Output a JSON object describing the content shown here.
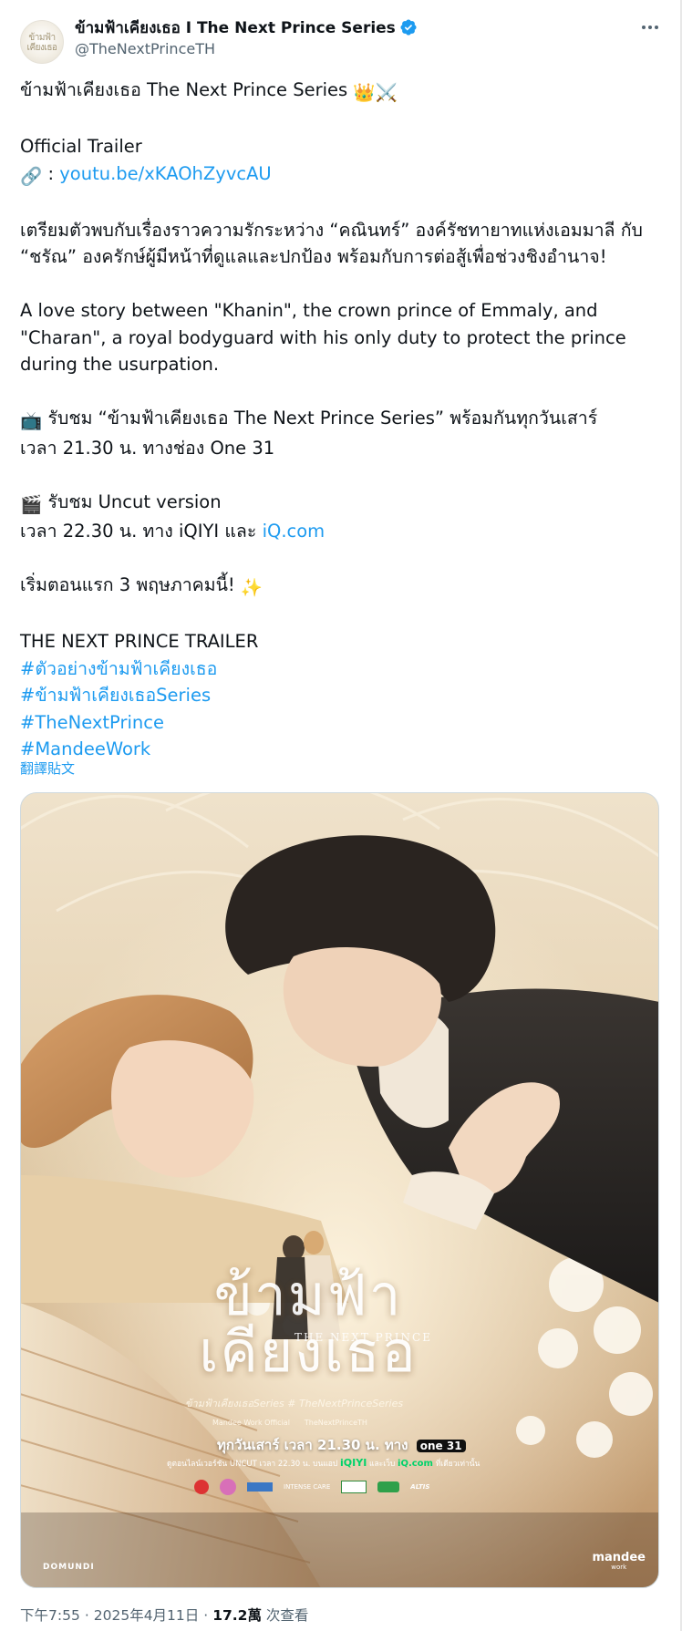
{
  "author": {
    "display_name": "ข้ามฟ้าเคียงเธอ I The Next Prince Series",
    "handle": "@TheNextPrinceTH",
    "avatar_text": "ข้ามฟ้า เคียงเธอ"
  },
  "tweet": {
    "line1": "ข้ามฟ้าเคียงเธอ The Next Prince Series",
    "line1_emoji": "👑⚔️",
    "official_trailer": "Official Trailer",
    "link_prefix_emoji": "🔗",
    "link_sep": " : ",
    "trailer_link": "youtu.be/xKAOhZyvcAU",
    "thai_para_1": "เตรียมตัวพบกับเรื่องราวความรักระหว่าง “คณินทร์” องค์รัชทายาทแห่งเอมมาลี กับ",
    "thai_para_2": "“ชรัณ” องครักษ์ผู้มีหน้าที่ดูแลและปกป้อง พร้อมกับการต่อสู้เพื่อช่วงชิงอำนาจ!",
    "en_para_1": "A love story between \"Khanin\", the crown prince of Emmaly, and",
    "en_para_2": "\"Charan\", a royal bodyguard with his only duty to protect the prince",
    "en_para_3": "during the usurpation.",
    "tv_emoji": "📺",
    "watch_line": " รับชม “ข้ามฟ้าเคียงเธอ The Next Prince Series” พร้อมกันทุกวันเสาร์",
    "time_line": "เวลา 21.30 น. ทางช่อง One 31",
    "clapper_emoji": "🎬",
    "uncut_line": " รับชม Uncut version",
    "uncut_time_prefix": "เวลา 22.30 น. ทาง iQIYI และ ",
    "iq_link": "iQ.com",
    "premiere_line": "เริ่มตอนแรก 3 พฤษภาคมนี้! ",
    "sparkle_emoji": "✨",
    "trailer_caps": "THE NEXT PRINCE TRAILER",
    "hashtags": [
      "#ตัวอย่างข้ามฟ้าเคียงเธอ",
      "#ข้ามฟ้าเคียงเธอSeries",
      "#TheNextPrince",
      "#MandeeWork"
    ],
    "translate": "翻譯貼文"
  },
  "poster": {
    "title_thai": "ข้ามฟ้า เคียงเธอ",
    "subtitle": "THE NEXT PRINCE",
    "tags": "ข้ามฟ้าเคียงเธอSeries  # TheNextPrinceSeries",
    "social_1": "Mandee Work Official",
    "social_2": "TheNextPrinceTH",
    "airtime_prefix": "ทุกวันเสาร์ เวลา 21.30 น. ทาง",
    "channel": "one 31",
    "uncut_note_prefix": "ดูตอนไลน์เวอร์ชัน UNCUT เวลา 22.30 น. บนแอป",
    "iqiyi": "iQIYI",
    "uncut_note_mid": "และเว็บ",
    "iq_com": "iQ.com",
    "uncut_note_suffix": "ที่เดียวเท่านั้น",
    "logo_left": "DOMUNDI",
    "logo_right": "mandee",
    "logo_right_sub": "work",
    "sponsor_1": "INTENSE CARE",
    "sponsor_2": "ALTIS"
  },
  "footer": {
    "time": "下午7:55",
    "date": "2025年4月11日",
    "views": "17.2萬",
    "views_label": " 次查看",
    "separator": "·"
  }
}
